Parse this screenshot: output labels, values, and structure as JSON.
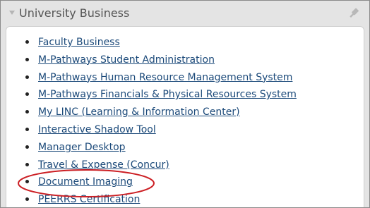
{
  "panel": {
    "title": "University Business",
    "icons": {
      "collapse": "triangle-down-icon",
      "pin": "pin-icon"
    }
  },
  "links": [
    {
      "label": "Faculty Business"
    },
    {
      "label": "M-Pathways Student Administration"
    },
    {
      "label": "M-Pathways Human Resource Management System"
    },
    {
      "label": "M-Pathways Financials & Physical Resources System"
    },
    {
      "label": "My LINC (Learning & Information Center)"
    },
    {
      "label": "Interactive Shadow Tool"
    },
    {
      "label": "Manager Desktop"
    },
    {
      "label": "Travel & Expense (Concur)"
    },
    {
      "label": "Document Imaging"
    },
    {
      "label": "PEERRS Certification"
    }
  ],
  "highlight": {
    "target": "Document Imaging",
    "color": "#cc1f24"
  },
  "colors": {
    "link": "#1c4a7a",
    "panel_background": "#e4e4e4",
    "content_background": "#ffffff"
  }
}
